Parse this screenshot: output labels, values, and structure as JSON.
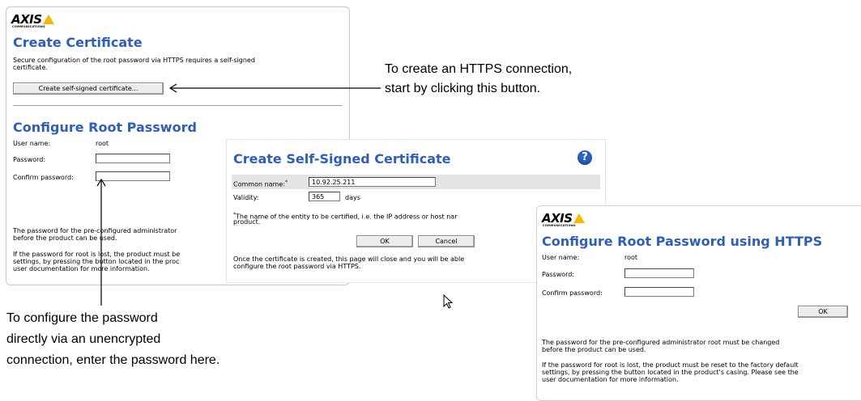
{
  "panel_main": {
    "logo": "AXIS",
    "logo_sub": "COMMUNICATIONS",
    "cert_title": "Create Certificate",
    "cert_desc_line1": "Secure configuration of the root password via HTTPS requires a self-signed",
    "cert_desc_line2": "certificate.",
    "create_cert_button": "Create self-signed certificate...",
    "root_title": "Configure Root Password",
    "username_label": "User name:",
    "username_value": "root",
    "password_label": "Password:",
    "confirm_label": "Confirm password:",
    "note1_line1": "The password for the pre-configured administrator",
    "note1_line2": "before the product can be used.",
    "note2_line1": "If the password for root is lost, the product must be",
    "note2_line2": "settings, by pressing the button located in the proc",
    "note2_line3": "user documentation for more information."
  },
  "panel_selfsigned": {
    "title": "Create Self-Signed Certificate",
    "common_name_label": "Common name:",
    "common_name_asterisk": "*",
    "common_name_value": "10.92.25.211",
    "validity_label": "Validity:",
    "validity_value": "365",
    "validity_unit": "days",
    "footnote_asterisk": "*",
    "footnote_line1": "The name of the entity to be certified, i.e. the IP address or host nar",
    "footnote_line2": "product.",
    "ok_button": "OK",
    "cancel_button": "Cancel",
    "info_line1": "Once the certificate is created, this page will close and you will be able",
    "info_line2": "configure the root password via HTTPS."
  },
  "panel_https": {
    "logo": "AXIS",
    "logo_sub": "COMMUNICATIONS",
    "title": "Configure Root Password using HTTPS",
    "username_label": "User name:",
    "username_value": "root",
    "password_label": "Password:",
    "confirm_label": "Confirm password:",
    "ok_button": "OK",
    "note1_line1": "The password for the pre-configured administrator root must be changed",
    "note1_line2": "before the product can be used.",
    "note2_line1": "If the password for root is lost, the product must be reset to the factory default",
    "note2_line2": "settings, by pressing the button located in the product's casing. Please see the",
    "note2_line3": "user documentation for more information."
  },
  "annotations": {
    "https_line1": "To create an HTTPS connection,",
    "https_line2": "start by clicking this button.",
    "plain_line1": "To configure the password",
    "plain_line2": "directly via an unencrypted",
    "plain_line3": "connection, enter the password here."
  },
  "colors": {
    "title_blue": "#2e5fb8",
    "logo_yellow": "#f5b800",
    "help_icon_blue": "#2e62c7"
  },
  "icons": [
    "help-icon",
    "mouse-cursor-icon",
    "arrow-left-icon",
    "arrow-up-icon"
  ]
}
